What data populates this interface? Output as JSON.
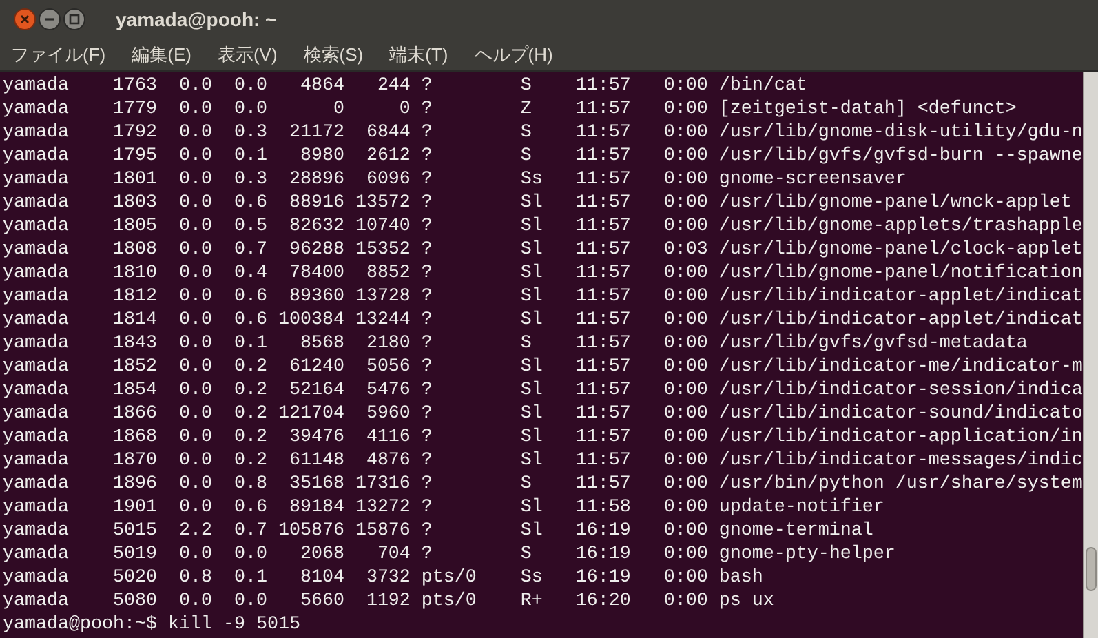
{
  "window": {
    "title": "yamada@pooh: ~"
  },
  "menu": [
    "ファイル(F)",
    "編集(E)",
    "表示(V)",
    "検索(S)",
    "端末(T)",
    "ヘルプ(H)"
  ],
  "terminal_lines": [
    "yamada    1763  0.0  0.0   4864   244 ?        S    11:57   0:00 /bin/cat",
    "yamada    1779  0.0  0.0      0     0 ?        Z    11:57   0:00 [zeitgeist-datah] <defunct>",
    "yamada    1792  0.0  0.3  21172  6844 ?        S    11:57   0:00 /usr/lib/gnome-disk-utility/gdu-n",
    "yamada    1795  0.0  0.1   8980  2612 ?        S    11:57   0:00 /usr/lib/gvfs/gvfsd-burn --spawne",
    "yamada    1801  0.0  0.3  28896  6096 ?        Ss   11:57   0:00 gnome-screensaver",
    "yamada    1803  0.0  0.6  88916 13572 ?        Sl   11:57   0:00 /usr/lib/gnome-panel/wnck-applet",
    "yamada    1805  0.0  0.5  82632 10740 ?        Sl   11:57   0:00 /usr/lib/gnome-applets/trashapple",
    "yamada    1808  0.0  0.7  96288 15352 ?        Sl   11:57   0:03 /usr/lib/gnome-panel/clock-applet",
    "yamada    1810  0.0  0.4  78400  8852 ?        Sl   11:57   0:00 /usr/lib/gnome-panel/notification",
    "yamada    1812  0.0  0.6  89360 13728 ?        Sl   11:57   0:00 /usr/lib/indicator-applet/indicat",
    "yamada    1814  0.0  0.6 100384 13244 ?        Sl   11:57   0:00 /usr/lib/indicator-applet/indicat",
    "yamada    1843  0.0  0.1   8568  2180 ?        S    11:57   0:00 /usr/lib/gvfs/gvfsd-metadata",
    "yamada    1852  0.0  0.2  61240  5056 ?        Sl   11:57   0:00 /usr/lib/indicator-me/indicator-m",
    "yamada    1854  0.0  0.2  52164  5476 ?        Sl   11:57   0:00 /usr/lib/indicator-session/indica",
    "yamada    1866  0.0  0.2 121704  5960 ?        Sl   11:57   0:00 /usr/lib/indicator-sound/indicato",
    "yamada    1868  0.0  0.2  39476  4116 ?        Sl   11:57   0:00 /usr/lib/indicator-application/in",
    "yamada    1870  0.0  0.2  61148  4876 ?        Sl   11:57   0:00 /usr/lib/indicator-messages/indic",
    "yamada    1896  0.0  0.8  35168 17316 ?        S    11:57   0:00 /usr/bin/python /usr/share/system",
    "yamada    1901  0.0  0.6  89184 13272 ?        Sl   11:58   0:00 update-notifier",
    "yamada    5015  2.2  0.7 105876 15876 ?        Sl   16:19   0:00 gnome-terminal",
    "yamada    5019  0.0  0.0   2068   704 ?        S    16:19   0:00 gnome-pty-helper",
    "yamada    5020  0.8  0.1   8104  3732 pts/0    Ss   16:19   0:00 bash",
    "yamada    5080  0.0  0.0   5660  1192 pts/0    R+   16:20   0:00 ps ux",
    "yamada@pooh:~$ kill -9 5015"
  ]
}
